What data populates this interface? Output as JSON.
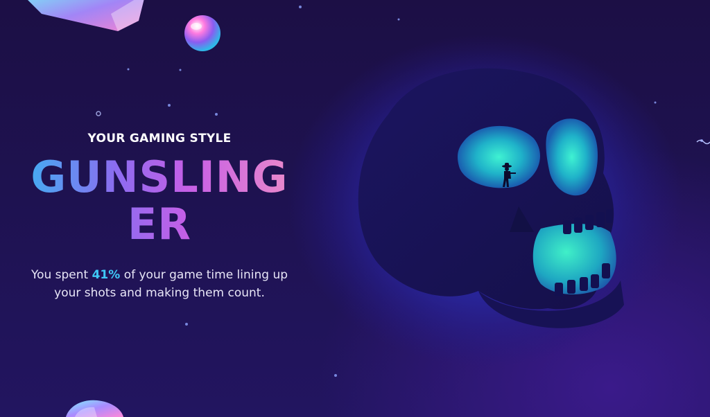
{
  "gaming_style": {
    "kicker": "YOUR GAMING STYLE",
    "name": "GUNSLINGER",
    "description_prefix": "You spent ",
    "highlight_percent": "41%",
    "description_suffix": " of your game time lining up your shots and making them count."
  },
  "colors": {
    "background": "#1c0f45",
    "accent_cyan": "#3fc8f6",
    "gradient_start": "#39b6f2",
    "gradient_mid": "#c65fe6",
    "gradient_end": "#ee8fc7",
    "glow": "#2fe0c6"
  },
  "illustration": {
    "main": "skull-illustration",
    "figure": "cowboy-silhouette-icon",
    "decorations": [
      "glowing-orb-icon",
      "neon-crystal-icon",
      "floating-capsule-icon"
    ]
  }
}
